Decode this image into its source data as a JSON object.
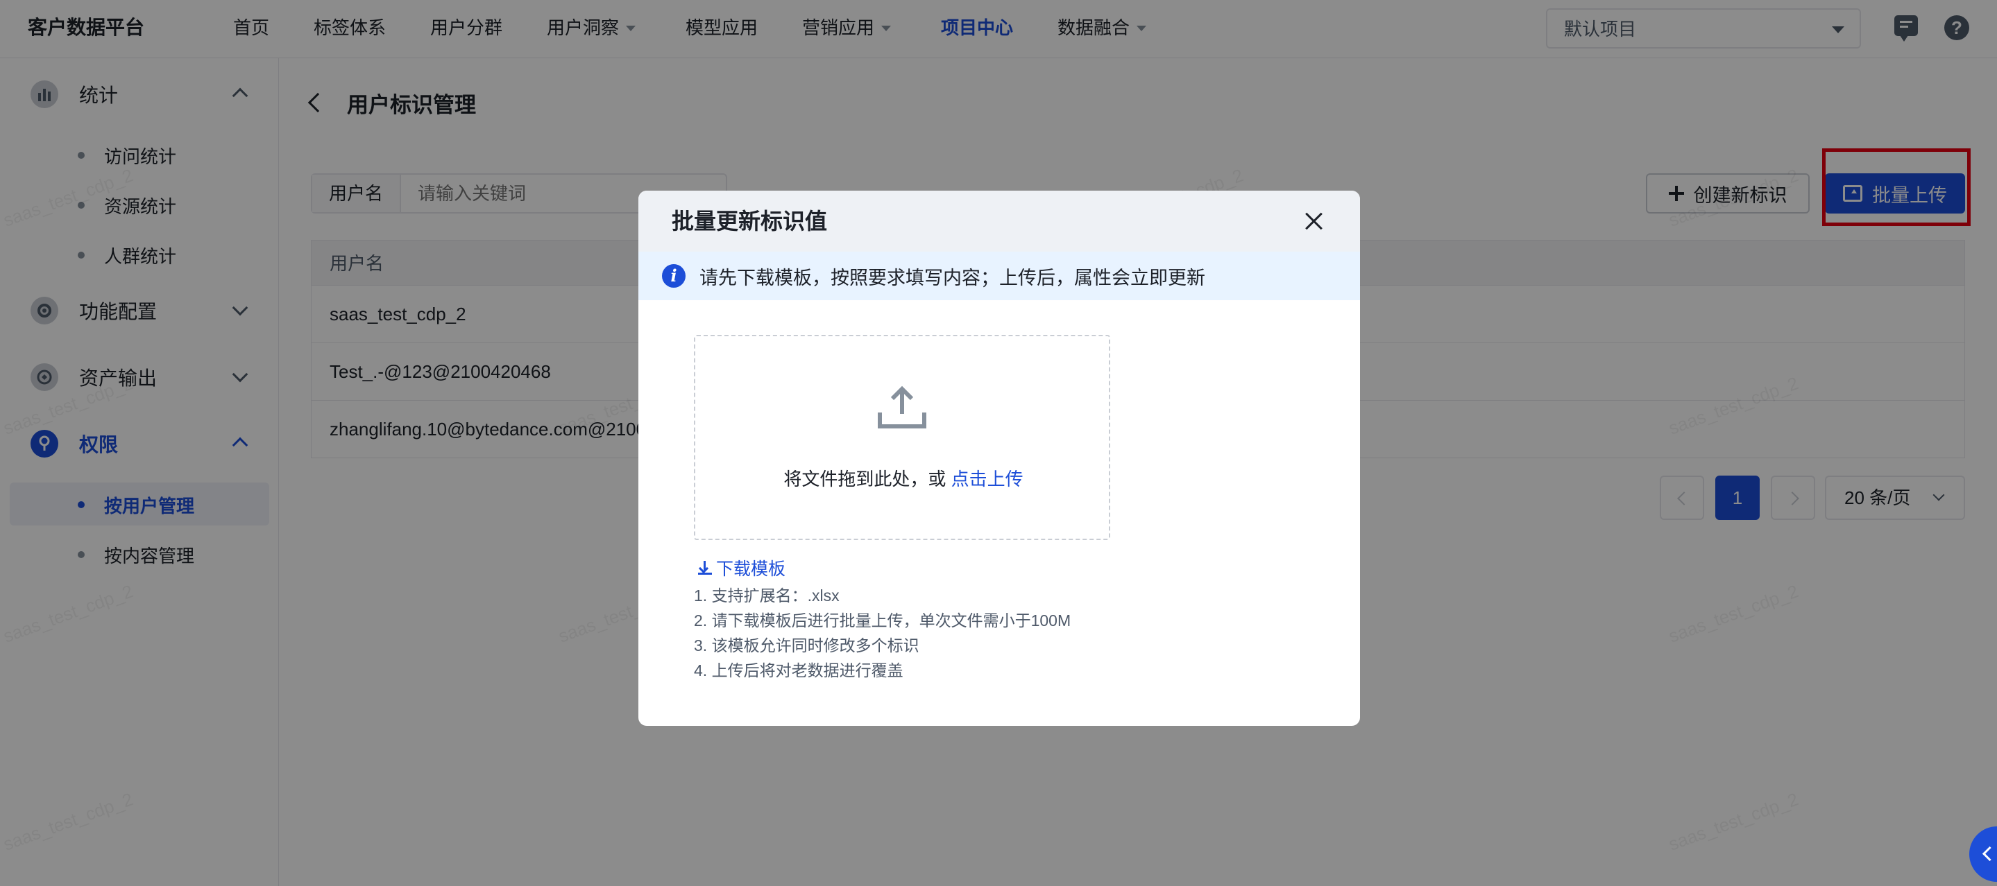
{
  "app": {
    "brand": "客户数据平台",
    "nav": [
      {
        "label": "首页",
        "has_caret": false,
        "active": false
      },
      {
        "label": "标签体系",
        "has_caret": false,
        "active": false
      },
      {
        "label": "用户分群",
        "has_caret": false,
        "active": false
      },
      {
        "label": "用户洞察",
        "has_caret": true,
        "active": false
      },
      {
        "label": "模型应用",
        "has_caret": false,
        "active": false
      },
      {
        "label": "营销应用",
        "has_caret": true,
        "active": false
      },
      {
        "label": "项目中心",
        "has_caret": false,
        "active": true
      },
      {
        "label": "数据融合",
        "has_caret": true,
        "active": false
      }
    ],
    "project_select": "默认项目"
  },
  "sidebar": {
    "groups": [
      {
        "label": "统计",
        "icon": "bar-chart-icon",
        "expanded": true,
        "items": [
          "访问统计",
          "资源统计",
          "人群统计"
        ]
      },
      {
        "label": "功能配置",
        "icon": "gear-icon",
        "expanded": false
      },
      {
        "label": "资产输出",
        "icon": "export-icon",
        "expanded": false
      },
      {
        "label": "权限",
        "icon": "key-icon",
        "expanded": true,
        "active": true,
        "items": [
          "按用户管理",
          "按内容管理"
        ],
        "active_item": "按用户管理"
      }
    ]
  },
  "page": {
    "title": "用户标识管理",
    "filter_label": "用户名",
    "filter_placeholder": "请输入关键词",
    "create_button": "创建新标识",
    "upload_button": "批量上传",
    "table": {
      "header": "用户名",
      "rows": [
        "saas_test_cdp_2",
        "Test_.-@123@2100420468",
        "zhanglifang.10@bytedance.com@2100"
      ]
    },
    "pagination": {
      "current_page": "1",
      "page_size": "20 条/页"
    },
    "watermark": "saas_test_cdp_2"
  },
  "modal": {
    "title": "批量更新标识值",
    "alert": "请先下载模板，按照要求填写内容；上传后，属性会立即更新",
    "dropzone_text": "将文件拖到此处，或",
    "dropzone_link": "点击上传",
    "download_template": "下载模板",
    "hints": [
      "1. 支持扩展名：.xlsx",
      "2. 请下载模板后进行批量上传，单次文件需小于100M",
      "3. 该模板允许同时修改多个标识",
      "4. 上传后将对老数据进行覆盖"
    ]
  },
  "colors": {
    "primary": "#1d4ed8",
    "highlight": "#e60012",
    "alert_bg": "#e8f3ff"
  }
}
